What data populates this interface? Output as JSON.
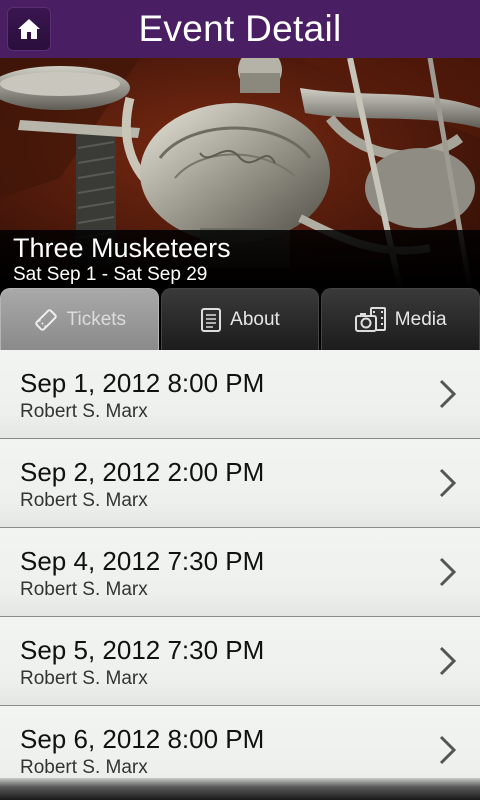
{
  "header": {
    "title": "Event Detail",
    "home_icon": "home-icon"
  },
  "event": {
    "name": "Three Musketeers",
    "dates": "Sat Sep 1 - Sat Sep 29"
  },
  "tabs": [
    {
      "label": "Tickets",
      "icon": "ticket-icon",
      "active": true
    },
    {
      "label": "About",
      "icon": "document-icon",
      "active": false
    },
    {
      "label": "Media",
      "icon": "camera-film-icon",
      "active": false
    }
  ],
  "performances": [
    {
      "date": "Sep 1, 2012 8:00 PM",
      "venue": "Robert S. Marx"
    },
    {
      "date": "Sep 2, 2012 2:00 PM",
      "venue": "Robert S. Marx"
    },
    {
      "date": "Sep 4, 2012 7:30 PM",
      "venue": "Robert S. Marx"
    },
    {
      "date": "Sep 5, 2012 7:30 PM",
      "venue": "Robert S. Marx"
    },
    {
      "date": "Sep 6, 2012 8:00 PM",
      "venue": "Robert S. Marx"
    }
  ],
  "colors": {
    "header_bg": "#4a1e63",
    "list_bg": "#eef0ee"
  }
}
